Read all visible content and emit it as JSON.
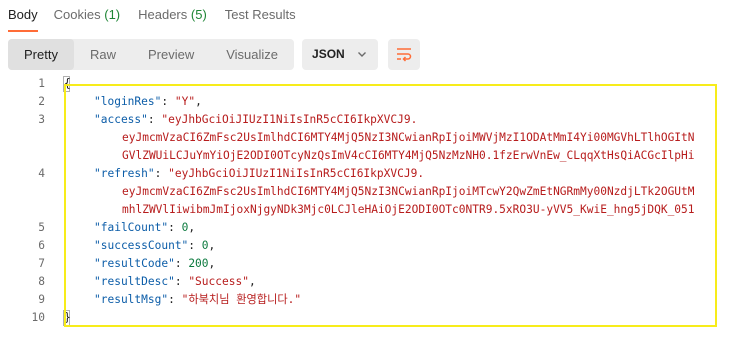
{
  "tabs": [
    {
      "label": "Body",
      "count": ""
    },
    {
      "label": "Cookies",
      "count": "(1)"
    },
    {
      "label": "Headers",
      "count": "(5)"
    },
    {
      "label": "Test Results",
      "count": ""
    }
  ],
  "toolbar": {
    "views": [
      "Pretty",
      "Raw",
      "Preview",
      "Visualize"
    ],
    "format": "JSON",
    "format_icon": "chevron-down-icon",
    "wrap_icon": "wrap-lines-icon"
  },
  "colors": {
    "accent": "#ff6c37",
    "key": "#0c5da8",
    "string": "#b71c1c",
    "number": "#0b7a3e",
    "highlight": "#f7ec1a"
  },
  "code": {
    "line_numbers": [
      "1",
      "2",
      "3",
      "4",
      "5",
      "6",
      "7",
      "8",
      "9",
      "10"
    ],
    "open_brace": "{",
    "close_brace": "}",
    "loginRes_key": "\"loginRes\"",
    "loginRes_val": "\"Y\"",
    "access_key": "\"access\"",
    "access_val_1": "\"eyJhbGciOiJIUzI1NiIsInR5cCI6IkpXVCJ9.",
    "access_val_2": "eyJmcmVzaCI6ZmFsc2UsImlhdCI6MTY4MjQ5NzI3NCwianRpIjoiMWVjMzI1ODAtMmI4Yi00MGVhLTlhOGItN",
    "access_val_3": "GVlZWUiLCJuYmYiOjE2ODI0OTcyNzQsImV4cCI6MTY4MjQ5NzMzNH0.1fzErwVnEw_CLqqXtHsQiACGcIlpHi",
    "refresh_key": "\"refresh\"",
    "refresh_val_1": "\"eyJhbGciOiJIUzI1NiIsInR5cCI6IkpXVCJ9.",
    "refresh_val_2": "eyJmcmVzaCI6ZmFsc2UsImlhdCI6MTY4MjQ5NzI3NCwianRpIjoiMTcwY2QwZmEtNGRmMy00NzdjLTk2OGUtM",
    "refresh_val_3": "mhlZWVlIiwibmJmIjoxNjgyNDk3Mjc0LCJleHAiOjE2ODI0OTc0NTR9.5xRO3U-yVV5_KwiE_hng5jDQK_051",
    "failCount_key": "\"failCount\"",
    "failCount_val": "0",
    "successCount_key": "\"successCount\"",
    "successCount_val": "0",
    "resultCode_key": "\"resultCode\"",
    "resultCode_val": "200",
    "resultDesc_key": "\"resultDesc\"",
    "resultDesc_val": "\"Success\"",
    "resultMsg_key": "\"resultMsg\"",
    "resultMsg_val": "\"하북치님 환영합니다.\""
  }
}
